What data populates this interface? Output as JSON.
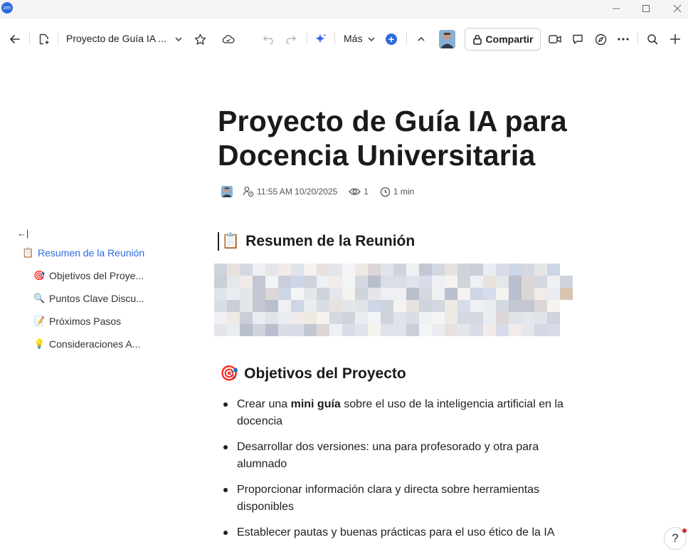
{
  "app": {
    "logo_text": "zm"
  },
  "toolbar": {
    "doc_title": "Proyecto de Guía IA ...",
    "more_label": "Más",
    "share_label": "Compartir",
    "icons": [
      "back-arrow-icon",
      "new-doc-icon",
      "chevron-down-icon",
      "star-icon",
      "cloud-icon",
      "undo-icon",
      "redo-icon",
      "ai-sparkle-icon",
      "plus-circle-icon",
      "chevron-up-icon",
      "lock-icon",
      "video-icon",
      "comment-icon",
      "compass-icon",
      "more-icon",
      "search-icon",
      "plus-icon"
    ]
  },
  "document": {
    "title": "Proyecto de Guía IA para Docencia Universitaria",
    "meta": {
      "timestamp": "11:55 AM 10/20/2025",
      "views": "1",
      "read_time": "1 min"
    },
    "sections": [
      {
        "emoji": "📋",
        "heading": "Resumen de la Reunión"
      },
      {
        "emoji": "🎯",
        "heading": "Objetivos del Proyecto"
      }
    ],
    "objectives": [
      {
        "before": "Crear una ",
        "bold": "mini guía",
        "after": " sobre el uso de la inteligencia artificial en la docencia"
      },
      {
        "before": "Desarrollar dos versiones: una para profesorado y otra para alumnado",
        "bold": "",
        "after": ""
      },
      {
        "before": "Proporcionar información clara y directa sobre herramientas disponibles",
        "bold": "",
        "after": ""
      },
      {
        "before": "Establecer pautas y buenas prácticas para el uso ético de la IA",
        "bold": "",
        "after": ""
      }
    ]
  },
  "outline": {
    "collapse_glyph": "←|",
    "items": [
      {
        "emoji": "📋",
        "label": "Resumen de la Reunión",
        "active": true
      },
      {
        "emoji": "🎯",
        "label": "Objetivos del Proye..."
      },
      {
        "emoji": "🔍",
        "label": "Puntos Clave Discu..."
      },
      {
        "emoji": "📝",
        "label": "Próximos Pasos"
      },
      {
        "emoji": "💡",
        "label": "Consideraciones A..."
      }
    ]
  },
  "help": {
    "label": "?"
  },
  "colors": {
    "accent": "#2d6cdf",
    "text": "#1f1f1f",
    "notification": "#e02424"
  }
}
